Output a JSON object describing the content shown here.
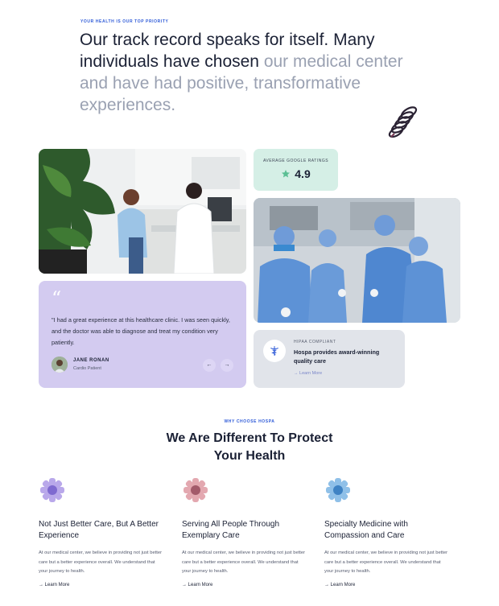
{
  "hero": {
    "eyebrow": "YOUR HEALTH IS OUR TOP PRIORITY",
    "headline_dark": "Our track record speaks for itself. Many individuals have chosen ",
    "headline_muted": "our medical center and have had positive, transformative experiences."
  },
  "rating": {
    "label": "AVERAGE GOOGLE RATINGS",
    "value": "4.9",
    "star_icon": "star-icon",
    "color": "#5bbf94"
  },
  "testimonial": {
    "quote": "\"I had a great experience at this healthcare clinic. I was seen quickly, and the doctor was able to diagnose and treat my condition very patiently.",
    "name": "JANE RONAN",
    "role": "Cardio Patient",
    "prev_arrow": "←",
    "next_arrow": "→"
  },
  "compliant": {
    "eyebrow": "HIPAA COMPLIANT",
    "title": "Hospa provides award-winning quality care",
    "link": "→ Learn More",
    "icon": "caduceus-icon"
  },
  "why": {
    "eyebrow": "WHY CHOOSE HOSPA",
    "title_regular": "We Are Different To ",
    "title_bold_1": "Protect",
    "title_bold_2": "Your Health"
  },
  "features": [
    {
      "title": "Not Just Better Care, But A Better Experience",
      "text": "At our medical center, we believe in providing not just better care but a better experience overall. We understand that your journey to health.",
      "link": "→ Learn More",
      "icon": "violet-star-icon"
    },
    {
      "title": "Serving All People Through Exemplary Care",
      "text": "At our medical center, we believe in providing not just better care but a better experience overall. We understand that your journey to health.",
      "link": "→ Learn More",
      "icon": "rose-star-icon"
    },
    {
      "title": "Specialty Medicine with Compassion and Care",
      "text": "At our medical center, we believe in providing not just better care but a better experience overall. We understand that your journey to health.",
      "link": "→ Learn More",
      "icon": "blue-star-icon"
    }
  ],
  "colors": {
    "accent": "#2f5bd8",
    "testimonial_bg": "#d3cbf0",
    "rating_bg": "#d5efe6",
    "compliant_bg": "#e1e4ea"
  }
}
